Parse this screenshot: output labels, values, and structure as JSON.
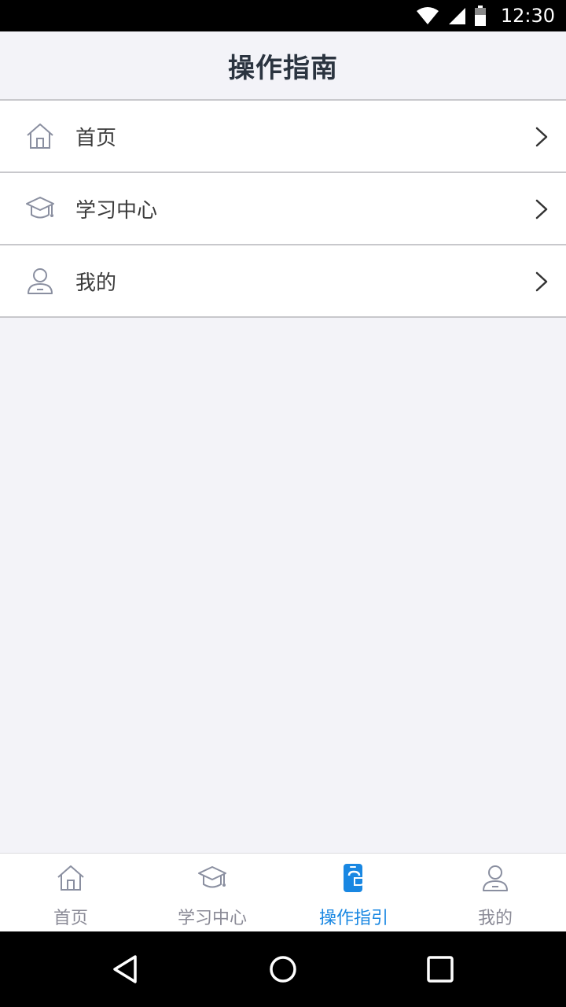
{
  "status_bar": {
    "time": "12:30"
  },
  "header": {
    "title": "操作指南"
  },
  "menu": [
    {
      "label": "首页",
      "icon": "home-icon"
    },
    {
      "label": "学习中心",
      "icon": "graduation-cap-icon"
    },
    {
      "label": "我的",
      "icon": "user-icon"
    }
  ],
  "tabs": [
    {
      "label": "首页",
      "icon": "home-icon"
    },
    {
      "label": "学习中心",
      "icon": "graduation-cap-icon"
    },
    {
      "label": "操作指引",
      "icon": "phone-guide-icon",
      "active": true
    },
    {
      "label": "我的",
      "icon": "user-icon"
    }
  ],
  "colors": {
    "accent": "#1987e2",
    "inactive": "#8a8a96",
    "background": "#f3f3f8",
    "title": "#2b3440"
  }
}
